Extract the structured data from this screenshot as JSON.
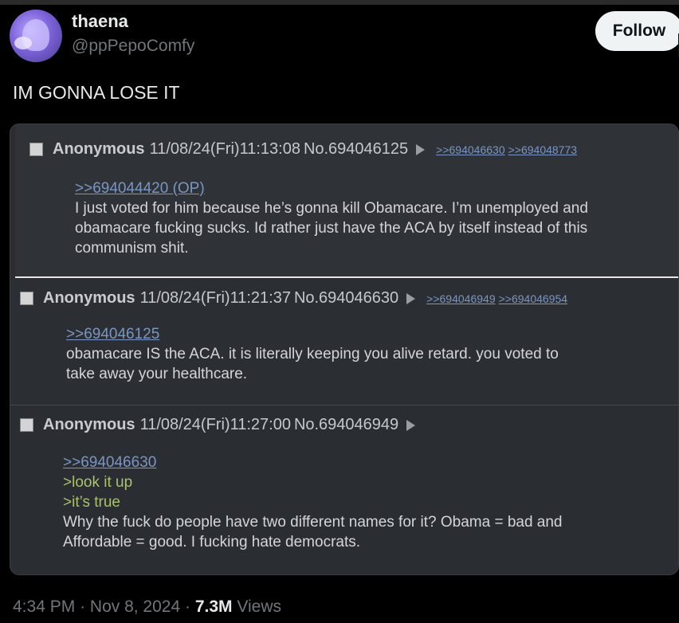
{
  "user": {
    "display_name": "thaena",
    "handle": "@ppPepoComfy",
    "follow_label": "Follow"
  },
  "tweet": {
    "text": "IM GONNA LOSE IT",
    "time": "4:34 PM",
    "date": "Nov 8, 2024",
    "views_count": "7.3M",
    "views_label": "Views",
    "separator": "·"
  },
  "posts": [
    {
      "name": "Anonymous",
      "datetime": "11/08/24(Fri)11:13:08",
      "post_no": "No.694046125",
      "replies": [
        ">>694046630",
        ">>694048773"
      ],
      "quote": ">>694044420 (OP)",
      "lines": [
        "I just voted for him because he’s gonna kill Obamacare. I’m unemployed and",
        "obamacare fucking sucks. Id rather just have the ACA by itself instead of this",
        "communism shit."
      ]
    },
    {
      "name": "Anonymous",
      "datetime": "11/08/24(Fri)11:21:37",
      "post_no": "No.694046630",
      "replies": [
        ">>694046949",
        ">>694046954"
      ],
      "quote": ">>694046125",
      "lines": [
        "obamacare IS the ACA. it is literally keeping you alive retard. you voted to",
        "take away your healthcare."
      ]
    },
    {
      "name": "Anonymous",
      "datetime": "11/08/24(Fri)11:27:00",
      "post_no": "No.694046949",
      "replies": [],
      "quote": ">>694046630",
      "greentext": [
        ">look it up",
        ">it’s true"
      ],
      "lines": [
        "Why the fuck do people have two different names for it? Obama = bad and",
        "Affordable = good. I fucking hate democrats."
      ]
    }
  ]
}
